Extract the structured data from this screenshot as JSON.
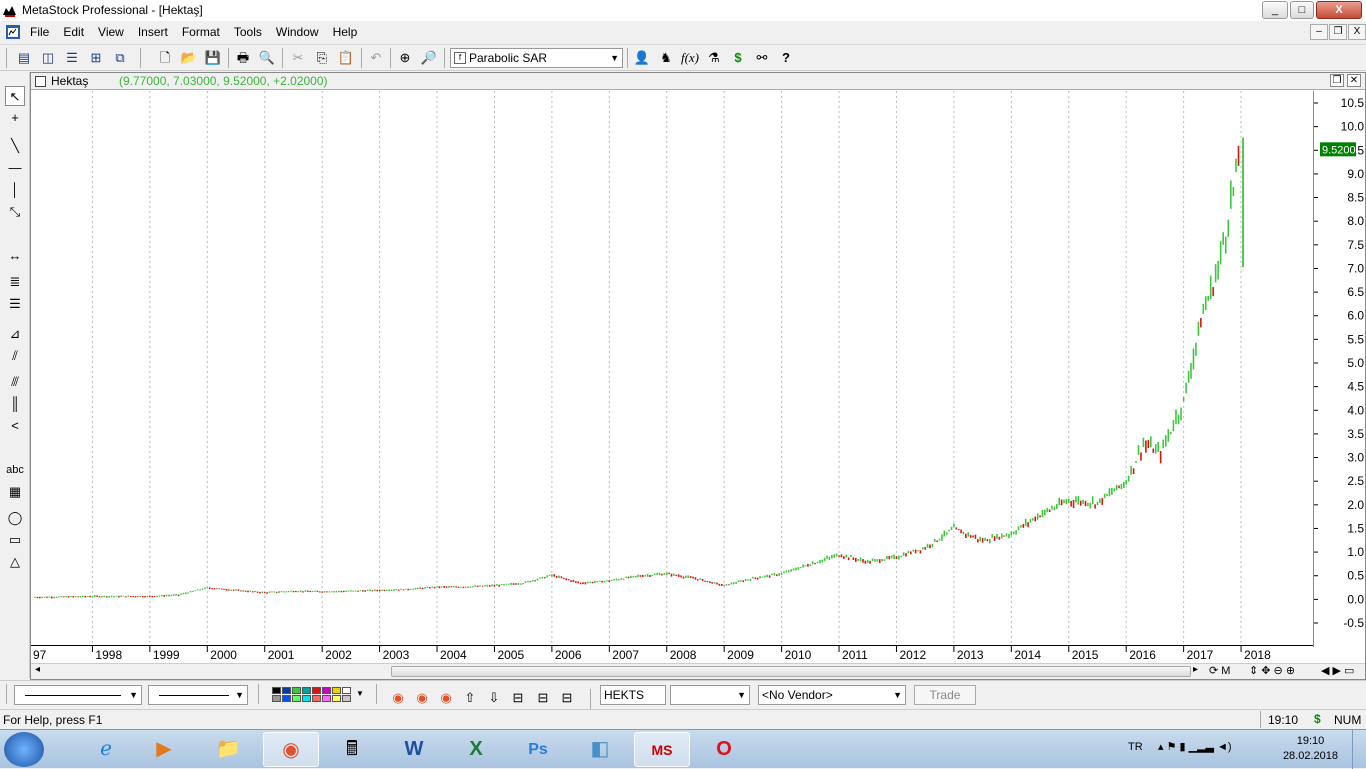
{
  "window": {
    "title": "MetaStock Professional - [Hektaş]",
    "min": "_",
    "max": "□",
    "close": "X"
  },
  "menu": [
    "File",
    "Edit",
    "View",
    "Insert",
    "Format",
    "Tools",
    "Window",
    "Help"
  ],
  "mdi": {
    "min": "–",
    "restore": "❐",
    "close": "X"
  },
  "toolbar": {
    "indicator": "Parabolic SAR",
    "icons": [
      "new-chart-icon",
      "tile-vertical-icon",
      "tile-horizontal-icon",
      "tile-grid-icon",
      "cascade-icon",
      "new-icon",
      "open-icon",
      "save-icon",
      "print-icon",
      "print-preview-icon",
      "cut-icon",
      "copy-icon",
      "paste-icon",
      "undo-icon",
      "crosshair-icon",
      "zoom-icon",
      "indicator-icon",
      "expert-icon",
      "formula-icon",
      "system-tester-icon",
      "dollar-icon",
      "explorer-icon",
      "help-icon"
    ]
  },
  "chart": {
    "security": "Hektaş",
    "values": "(9.77000, 7.03000, 9.52000, +2.02000)",
    "last_price": "9.5200",
    "up_color": "#3cc83c",
    "down_color": "#e01010"
  },
  "chart_data": {
    "type": "bar",
    "title": "Hektaş",
    "x_labels": [
      "97",
      "1998",
      "1999",
      "2000",
      "2001",
      "2002",
      "2003",
      "2004",
      "2005",
      "2006",
      "2007",
      "2008",
      "2009",
      "2010",
      "2011",
      "2012",
      "2013",
      "2014",
      "2015",
      "2016",
      "2017",
      "2018"
    ],
    "y_ticks": [
      "10.5",
      "10.0",
      "9.5",
      "9.0",
      "8.5",
      "8.0",
      "7.5",
      "7.0",
      "6.5",
      "6.0",
      "5.5",
      "5.0",
      "4.5",
      "4.0",
      "3.5",
      "3.0",
      "2.5",
      "2.0",
      "1.5",
      "1.0",
      "0.5",
      "0.0",
      "-0.5"
    ],
    "ylim": [
      -0.5,
      10.5
    ],
    "series": [
      {
        "x": 1997.0,
        "close": 0.05
      },
      {
        "x": 1998.0,
        "close": 0.07
      },
      {
        "x": 1999.0,
        "close": 0.07
      },
      {
        "x": 1999.5,
        "close": 0.1
      },
      {
        "x": 2000.0,
        "close": 0.25
      },
      {
        "x": 2000.5,
        "close": 0.2
      },
      {
        "x": 2001.0,
        "close": 0.15
      },
      {
        "x": 2001.5,
        "close": 0.18
      },
      {
        "x": 2002.0,
        "close": 0.17
      },
      {
        "x": 2002.5,
        "close": 0.18
      },
      {
        "x": 2003.0,
        "close": 0.2
      },
      {
        "x": 2003.5,
        "close": 0.22
      },
      {
        "x": 2004.0,
        "close": 0.27
      },
      {
        "x": 2004.5,
        "close": 0.27
      },
      {
        "x": 2005.0,
        "close": 0.3
      },
      {
        "x": 2005.5,
        "close": 0.35
      },
      {
        "x": 2006.0,
        "close": 0.52
      },
      {
        "x": 2006.5,
        "close": 0.35
      },
      {
        "x": 2007.0,
        "close": 0.4
      },
      {
        "x": 2007.5,
        "close": 0.5
      },
      {
        "x": 2008.0,
        "close": 0.55
      },
      {
        "x": 2008.5,
        "close": 0.45
      },
      {
        "x": 2009.0,
        "close": 0.3
      },
      {
        "x": 2009.5,
        "close": 0.45
      },
      {
        "x": 2010.0,
        "close": 0.55
      },
      {
        "x": 2010.5,
        "close": 0.75
      },
      {
        "x": 2011.0,
        "close": 0.95
      },
      {
        "x": 2011.5,
        "close": 0.8
      },
      {
        "x": 2012.0,
        "close": 0.9
      },
      {
        "x": 2012.5,
        "close": 1.1
      },
      {
        "x": 2013.0,
        "close": 1.5
      },
      {
        "x": 2013.5,
        "close": 1.25
      },
      {
        "x": 2014.0,
        "close": 1.4
      },
      {
        "x": 2014.5,
        "close": 1.8
      },
      {
        "x": 2015.0,
        "close": 2.1
      },
      {
        "x": 2015.5,
        "close": 2.05
      },
      {
        "x": 2016.0,
        "close": 2.5
      },
      {
        "x": 2016.3,
        "close": 3.3
      },
      {
        "x": 2016.6,
        "close": 3.1
      },
      {
        "x": 2017.0,
        "close": 4.2
      },
      {
        "x": 2017.3,
        "close": 5.9
      },
      {
        "x": 2017.6,
        "close": 7.0
      },
      {
        "x": 2018.0,
        "close": 9.52
      }
    ]
  },
  "bottom": {
    "symbol": "HEKTS",
    "vendor": "<No Vendor>",
    "trade": "Trade",
    "palette": [
      "#000000",
      "#003c96",
      "#3cc83c",
      "#00a0a0",
      "#e01010",
      "#c800c8",
      "#f0d200",
      "#ffffff",
      "#969696",
      "#0050ff",
      "#64ff64",
      "#00e6e6",
      "#ff6464",
      "#ff64ff",
      "#ffff64",
      "#c8c8c8"
    ]
  },
  "status": {
    "help": "For Help, press F1",
    "time": "19:10",
    "dollar": "$",
    "num": "NUM"
  },
  "taskbar": {
    "apps": [
      "start-icon",
      "ie-icon",
      "media-player-icon",
      "explorer-icon",
      "chrome-icon",
      "calculator-icon",
      "word-icon",
      "excel-icon",
      "photoshop-icon",
      "notes-icon",
      "metastock-icon",
      "opera-icon"
    ],
    "lang": "TR",
    "time": "19:10",
    "date": "28.02.2018"
  }
}
